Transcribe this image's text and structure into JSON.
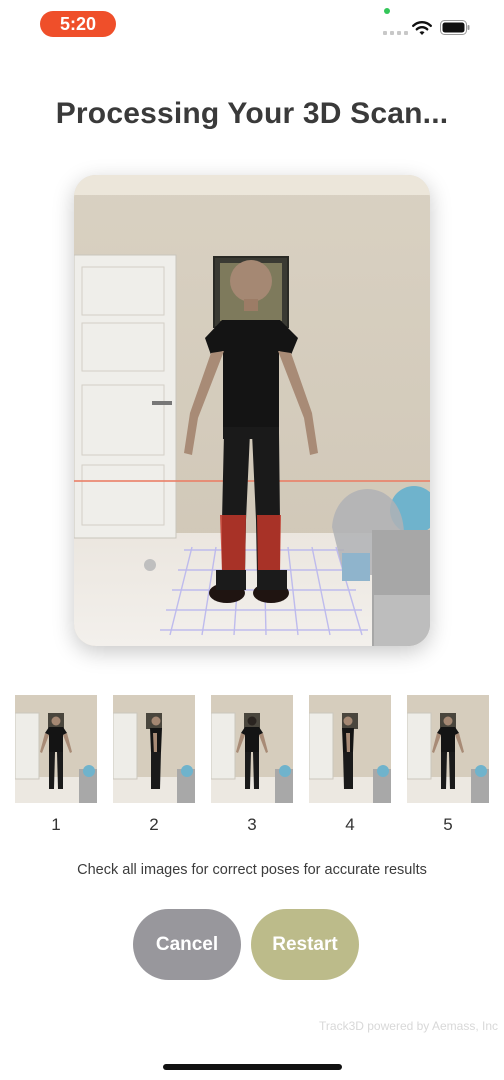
{
  "status_bar": {
    "time": "5:20",
    "icons": [
      "signal-icon",
      "wifi-icon",
      "battery-icon"
    ]
  },
  "screen": {
    "title": "Processing Your 3D Scan..."
  },
  "scan_preview": {
    "image": "person-standing-a-pose-photo"
  },
  "thumbnails": [
    {
      "label": "1",
      "pose": "front"
    },
    {
      "label": "2",
      "pose": "side"
    },
    {
      "label": "3",
      "pose": "back"
    },
    {
      "label": "4",
      "pose": "side"
    },
    {
      "label": "5",
      "pose": "front"
    }
  ],
  "hint_text": "Check all images for correct poses for accurate results",
  "buttons": {
    "cancel": "Cancel",
    "restart": "Restart"
  },
  "footer_text": "Track3D powered by Aemass, Inc",
  "colors": {
    "time_pill": "#ef4f2a",
    "cancel": "#98979c",
    "restart": "#bcbb8a"
  }
}
